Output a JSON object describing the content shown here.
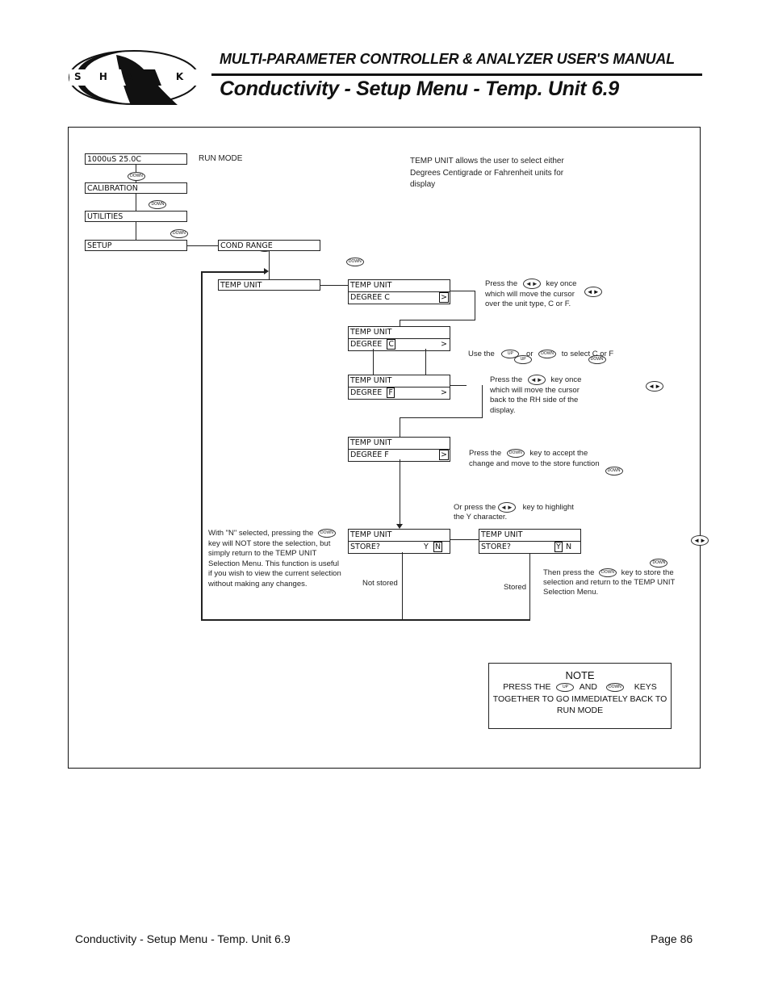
{
  "header": {
    "logo_text": "S H A R K",
    "manual_title": "MULTI-PARAMETER CONTROLLER & ANALYZER USER'S MANUAL",
    "page_title": "Conductivity - Setup Menu - Temp. Unit 6.9"
  },
  "keys": {
    "down": "DOWN",
    "up": "UP",
    "left_right": "◄►"
  },
  "menu": {
    "run_display": "1000uS   25.0C",
    "run_mode_label": "RUN MODE",
    "calibration": "CALIBRATION",
    "utilities": "UTILITIES",
    "setup": "SETUP",
    "cond_range": "COND RANGE",
    "temp_unit": "TEMP UNIT"
  },
  "intro_text": "TEMP UNIT allows the user to select either Degrees Centigrade or Fahrenheit units for display",
  "screens": {
    "s1": {
      "line1": "TEMP UNIT",
      "line2": "DEGREE    C",
      "cursor": ">"
    },
    "s2": {
      "line1": "TEMP UNIT",
      "line2": "DEGREE",
      "cursor": "C",
      "right": ">"
    },
    "s3": {
      "line1": "TEMP UNIT",
      "line2": "DEGREE",
      "cursor": "F",
      "right": ">"
    },
    "s4": {
      "line1": "TEMP UNIT",
      "line2": "DEGREE    F",
      "cursor": ">"
    },
    "store_n": {
      "line1": "TEMP UNIT",
      "line2": "STORE?",
      "y": "Y",
      "n": "N"
    },
    "store_y": {
      "line1": "TEMP UNIT",
      "line2": "STORE?",
      "y": "Y",
      "n": "N"
    }
  },
  "notes": {
    "n1_a": "Press the",
    "n1_b": "key once",
    "n1_c": "which will move the cursor",
    "n1_d": "over the unit type, C or F.",
    "n2_a": "Use the",
    "n2_b": "or",
    "n2_c": "to select C or F",
    "n3_a": "Press the",
    "n3_b": "key once",
    "n3_c": "which will move the cursor",
    "n3_d": "back to the RH side of the",
    "n3_e": "display.",
    "n4_a": "Press the",
    "n4_b": "key to accept the",
    "n4_c": "change and move to the store function",
    "n5_a": "Or press the",
    "n5_b": "key to highlight",
    "n5_c": "the Y character.",
    "n6_a": "With \"N\" selected, pressing the",
    "n6_b": "key will NOT store the selection, but",
    "n6_c": "simply return to the TEMP UNIT",
    "n6_d": "Selection Menu. This function is useful",
    "n6_e": "if you wish to view the current selection",
    "n6_f": "without making any changes.",
    "not_stored": "Not stored",
    "stored": "Stored",
    "n7_a": "Then press the",
    "n7_b": "key to store the",
    "n7_c": "selection and return to the TEMP UNIT",
    "n7_d": "Selection Menu."
  },
  "note_box": {
    "title": "NOTE",
    "line1_a": "PRESS THE",
    "line1_b": "AND",
    "line1_c": "KEYS",
    "line2": "TOGETHER TO GO IMMEDIATELY BACK TO",
    "line3": "RUN MODE"
  },
  "footer": {
    "section": "Conductivity - Setup Menu - Temp. Unit 6.9",
    "page": "Page 86"
  }
}
